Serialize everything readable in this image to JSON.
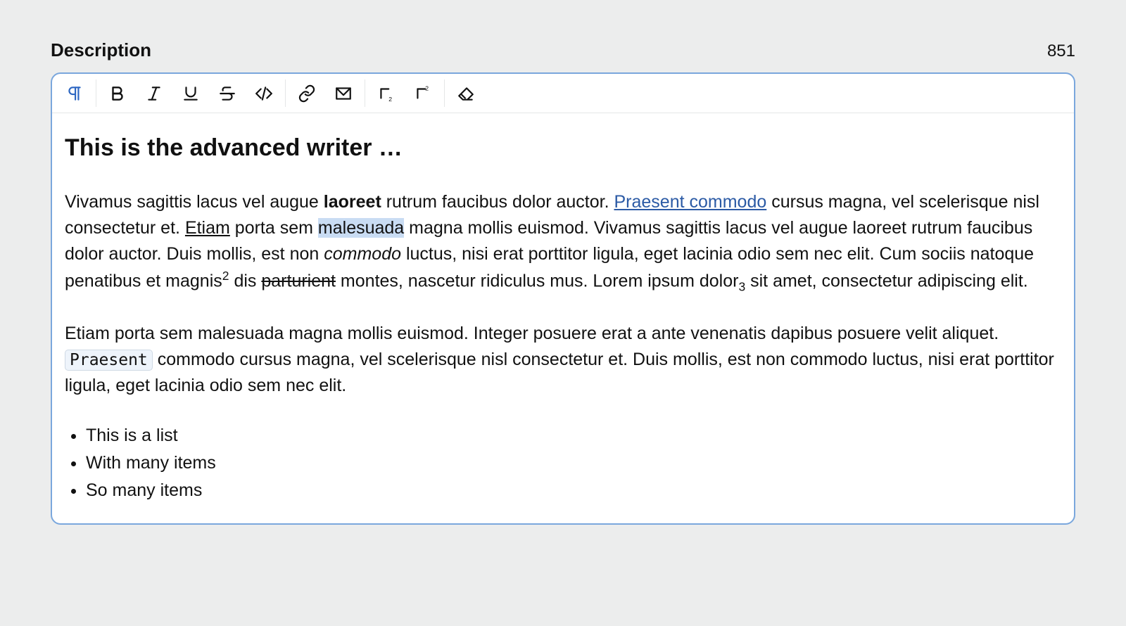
{
  "header": {
    "label": "Description",
    "counter": "851"
  },
  "toolbar": {
    "paragraph": "paragraph",
    "bold": "bold",
    "italic": "italic",
    "underline": "underline",
    "strike": "strikethrough",
    "code": "code",
    "link": "link",
    "hardbreak": "hard-break",
    "subscript": "subscript",
    "superscript": "superscript",
    "clear": "clear-formatting"
  },
  "editor": {
    "heading": "This is the advanced writer …",
    "p1": {
      "t1": "Vivamus sagittis lacus vel augue ",
      "bold1": "laoreet",
      "t2": " rutrum faucibus dolor auctor. ",
      "link1": "Praesent commodo",
      "t3": " cursus magna, vel scelerisque nisl consectetur et. ",
      "under1": "Etiam",
      "t4": " porta sem ",
      "hl1": "malesuada",
      "t5": " magna mollis euismod. Vivamus sagittis lacus vel augue laoreet rutrum faucibus dolor auctor. Duis mollis, est non ",
      "ital1": "commodo",
      "t6": " luctus, nisi erat porttitor ligula, eget lacinia odio sem nec elit. Cum sociis natoque penatibus et magnis",
      "sup1": "2",
      "t7": " dis ",
      "strike1": "parturient",
      "t8": " montes, nascetur ridiculus mus. Lorem ipsum dolor",
      "sub1": "3",
      "t9": " sit amet, consectetur adipiscing elit."
    },
    "p2": {
      "t1": "Etiam porta sem malesuada magna mollis euismod. Integer posuere erat a ante venenatis dapibus posuere velit aliquet. ",
      "code1": "Praesent",
      "t2": " commodo cursus magna, vel scelerisque nisl consectetur et. Duis mollis, est non commodo luctus, nisi erat porttitor ligula, eget lacinia odio sem nec elit."
    },
    "list": [
      "This is a list",
      "With many items",
      "So many items"
    ]
  }
}
